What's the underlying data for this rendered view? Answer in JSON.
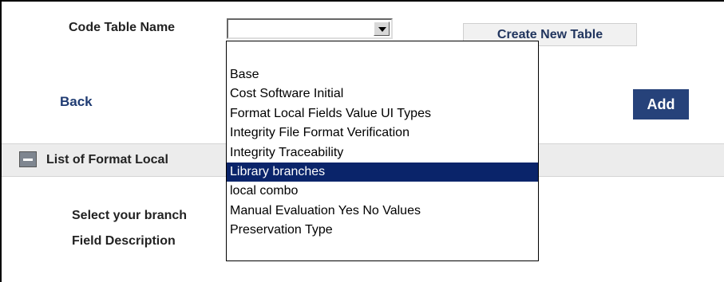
{
  "form": {
    "code_table_label": "Code Table Name",
    "combo_value": "",
    "create_button": "Create New Table",
    "back_link": "Back",
    "add_button": "Add"
  },
  "section": {
    "title": "List of Format Local",
    "select_branch_label": "Select your branch",
    "field_description_label": "Field Description"
  },
  "dropdown": {
    "options": [
      "Base",
      "Cost Software Initial",
      "Format Local Fields Value UI Types",
      "Integrity File Format Verification",
      "Integrity Traceability",
      "Library branches",
      "local combo",
      "Manual Evaluation Yes No Values",
      "Preservation Type"
    ],
    "highlighted_index": 5
  },
  "colors": {
    "highlight": "#0a246a",
    "add_button_bg": "#26427a",
    "link_text": "#1f3b72"
  }
}
